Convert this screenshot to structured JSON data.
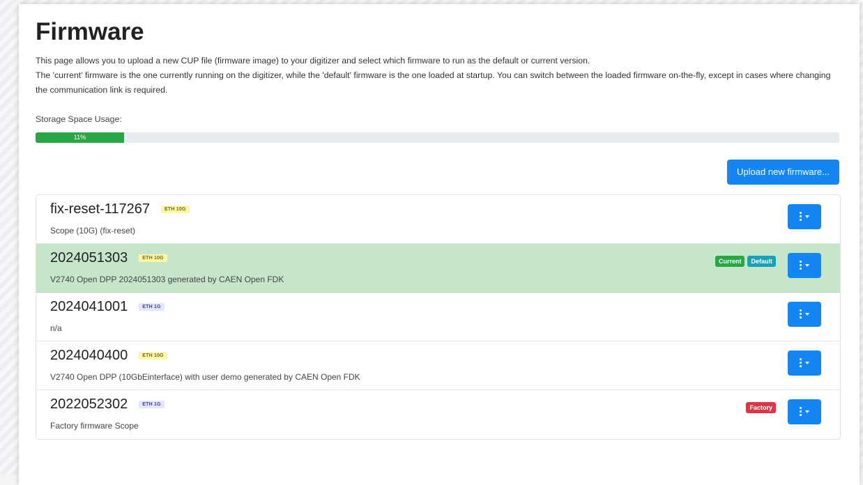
{
  "page": {
    "title": "Firmware",
    "description_1": "This page allows you to upload a new CUP file (firmware image) to your digitizer and select which firmware to run as the default or current version.",
    "description_2": "The 'current' firmware is the one currently running on the digitizer, while the 'default' firmware is the one loaded at startup. You can switch between the loaded firmware on-the-fly, except in cases where changing the communication link is required."
  },
  "storage": {
    "label": "Storage Space Usage:",
    "percent": 11,
    "percent_text": "11%"
  },
  "upload": {
    "label": "Upload new firmware..."
  },
  "colors": {
    "primary": "#1486f4",
    "success": "#28a745",
    "info": "#17a2b8",
    "danger": "#dc3545",
    "active_row": "#c5e6cb"
  },
  "firmwares": [
    {
      "name": "fix-reset-117267",
      "link": "ETH 10G",
      "desc": "Scope (10G) (fix-reset)"
    },
    {
      "name": "2024051303",
      "link": "ETH 10G",
      "desc": "V2740 Open DPP 2024051303 generated by CAEN Open FDK",
      "badge_current": "Current",
      "badge_default": "Default"
    },
    {
      "name": "2024041001",
      "link": "ETH 1G",
      "desc": "n/a"
    },
    {
      "name": "2024040400",
      "link": "ETH 10G",
      "desc": "V2740 Open DPP (10GbEinterface) with user demo generated by CAEN Open FDK"
    },
    {
      "name": "2022052302",
      "link": "ETH 1G",
      "desc": "Factory firmware Scope",
      "badge_factory": "Factory"
    }
  ],
  "icons": {
    "menu": "kebab-vertical-icon",
    "dropdown": "caret-down-icon"
  }
}
